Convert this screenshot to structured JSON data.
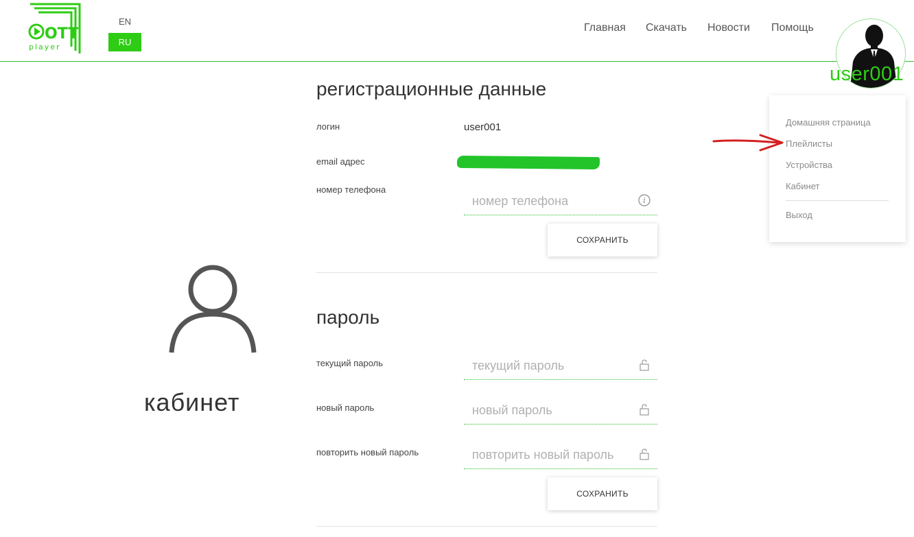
{
  "header": {
    "logo_text": "OTT",
    "logo_sub": "player",
    "lang": {
      "en": "EN",
      "ru": "RU",
      "active": "RU"
    },
    "nav": [
      "Главная",
      "Скачать",
      "Новости",
      "Помощь"
    ],
    "username": "user001",
    "accent_color": "#2ecc14"
  },
  "sidebar": {
    "title": "кабинет",
    "icon": "user-outline-icon"
  },
  "registration": {
    "title": "регистрационные данные",
    "login_label": "логин",
    "login_value": "user001",
    "email_label": "email адрес",
    "phone_label": "номер телефона",
    "phone_placeholder": "номер телефона",
    "save": "СОХРАНИТЬ"
  },
  "password": {
    "title": "пароль",
    "current_label": "текущий пароль",
    "current_placeholder": "текущий пароль",
    "new_label": "новый пароль",
    "new_placeholder": "новый пароль",
    "repeat_label": "повторить новый пароль",
    "repeat_placeholder": "повторить новый пароль",
    "save": "СОХРАНИТЬ"
  },
  "user_menu": {
    "items": [
      "Домашняя страница",
      "Плейлисты",
      "Устройства",
      "Кабинет"
    ],
    "logout": "Выход"
  }
}
